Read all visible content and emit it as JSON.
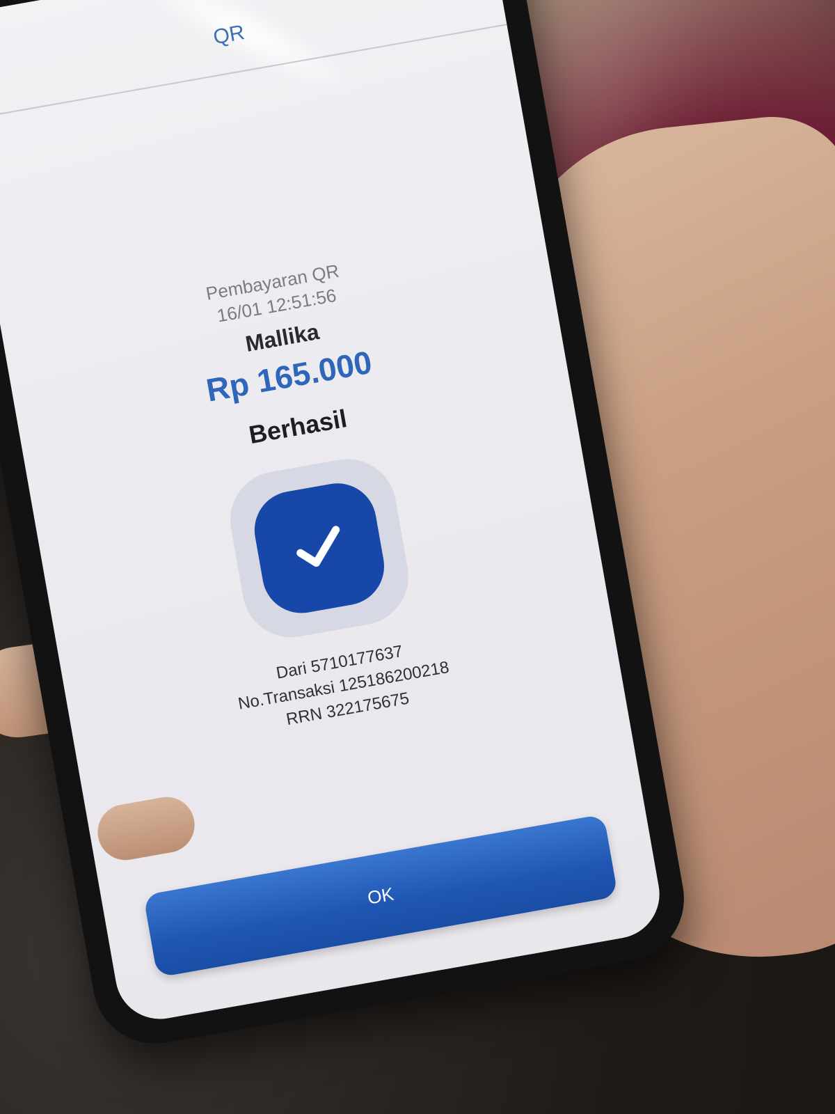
{
  "header": {
    "title": "QR"
  },
  "payment": {
    "type_label": "Pembayaran QR",
    "datetime": "16/01 12:51:56",
    "merchant": "Mallika",
    "amount": "Rp 165.000",
    "status": "Berhasil"
  },
  "details": {
    "from": "Dari 5710177637",
    "transaction_no": "No.Transaksi 125186200218",
    "rrn": "RRN 322175675"
  },
  "actions": {
    "ok_label": "OK"
  },
  "colors": {
    "accent_blue": "#2f66b9",
    "badge_blue": "#1747a8",
    "button_blue": "#1f56b3"
  },
  "icons": {
    "success": "checkmark-icon"
  }
}
